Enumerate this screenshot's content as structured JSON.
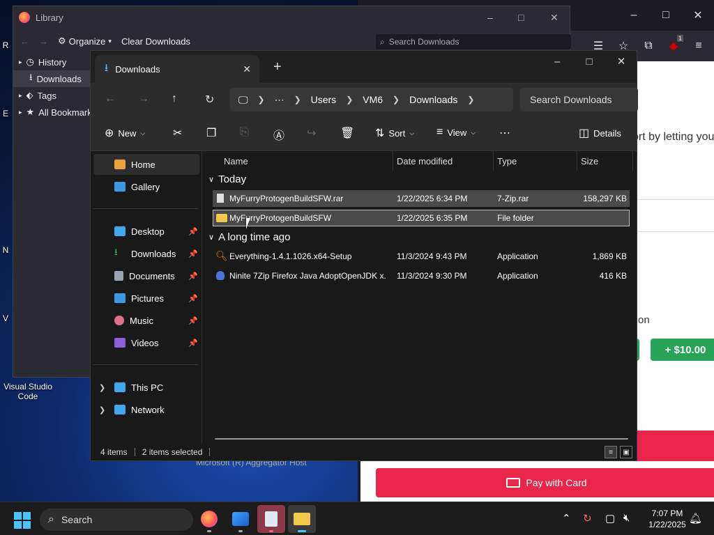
{
  "desktop": {
    "icons": [
      {
        "label": "Visual Studio Code"
      }
    ],
    "partial_labels": [
      "R",
      "E",
      "N",
      "V"
    ]
  },
  "browser": {
    "page_text_1": "ort by letting you",
    "page_text_2": "on",
    "amount_button": "+ $10.00",
    "pay_button": "Pay with Card",
    "badge": "1"
  },
  "library": {
    "title": "Library",
    "organize": "Organize",
    "clear_downloads": "Clear Downloads",
    "search_placeholder": "Search Downloads",
    "tree": [
      {
        "label": "History"
      },
      {
        "label": "Downloads"
      },
      {
        "label": "Tags"
      },
      {
        "label": "All Bookmarks"
      }
    ],
    "hidden_row": "Microsoft (R) Aggregator Host"
  },
  "explorer": {
    "tab_title": "Downloads",
    "breadcrumb": [
      "Users",
      "VM6",
      "Downloads"
    ],
    "search_placeholder": "Search Downloads",
    "commands": {
      "new": "New",
      "sort": "Sort",
      "view": "View",
      "details": "Details"
    },
    "nav": {
      "home": "Home",
      "gallery": "Gallery",
      "desktop": "Desktop",
      "downloads": "Downloads",
      "documents": "Documents",
      "pictures": "Pictures",
      "music": "Music",
      "videos": "Videos",
      "this_pc": "This PC",
      "network": "Network"
    },
    "columns": {
      "name": "Name",
      "date": "Date modified",
      "type": "Type",
      "size": "Size"
    },
    "groups": {
      "today": "Today",
      "long_ago": "A long time ago"
    },
    "files": [
      {
        "name": "MyFurryProtogenBuildSFW.rar",
        "date": "1/22/2025 6:34 PM",
        "type": "7-Zip.rar",
        "size": "158,297 KB"
      },
      {
        "name": "MyFurryProtogenBuildSFW",
        "date": "1/22/2025 6:35 PM",
        "type": "File folder",
        "size": ""
      },
      {
        "name": "Everything-1.4.1.1026.x64-Setup",
        "date": "11/3/2024 9:43 PM",
        "type": "Application",
        "size": "1,869 KB"
      },
      {
        "name": "Ninite 7Zip Firefox Java AdoptOpenJDK x...",
        "date": "11/3/2024 9:30 PM",
        "type": "Application",
        "size": "416 KB"
      }
    ],
    "status": {
      "count": "4 items",
      "selected": "2 items selected"
    }
  },
  "taskbar": {
    "search": "Search",
    "time": "7:07 PM",
    "date": "1/22/2025"
  },
  "colors": {
    "accent": "#4cc2ff",
    "pay": "#e8254a",
    "green": "#27a35a"
  }
}
